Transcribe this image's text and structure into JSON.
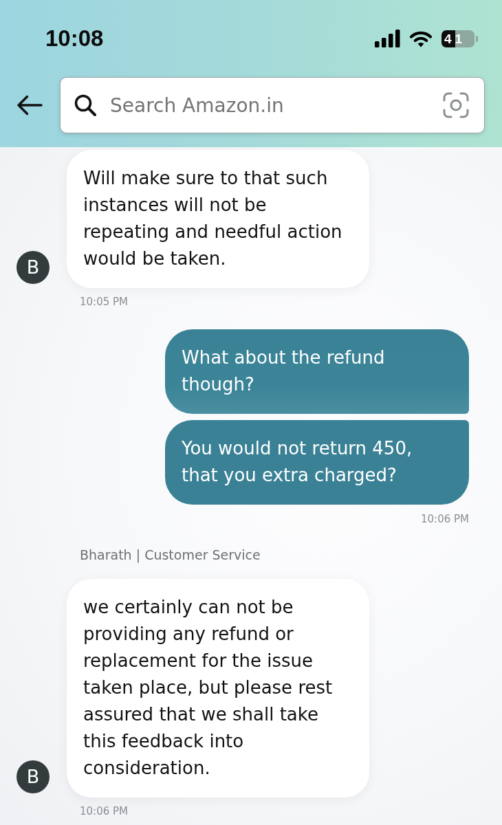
{
  "status_bar": {
    "time": "10:08",
    "battery": "41"
  },
  "search": {
    "placeholder": "Search Amazon.in"
  },
  "messages": [
    {
      "kind": "incoming",
      "avatar": "B",
      "bubbles": [
        "Will make sure to that such instances will not be repeating and needful action would be taken."
      ],
      "time": "10:05 PM"
    },
    {
      "kind": "outgoing",
      "bubbles": [
        "What about the refund though?",
        "You would not return 450, that you extra charged?"
      ],
      "time": "10:06 PM"
    },
    {
      "kind": "incoming",
      "sender": "Bharath | Customer Service",
      "avatar": "B",
      "bubbles": [
        "we certainly can not be providing any refund or replacement for the issue taken place, but please rest assured that we shall take this feedback into consideration."
      ],
      "time": "10:06 PM"
    }
  ]
}
